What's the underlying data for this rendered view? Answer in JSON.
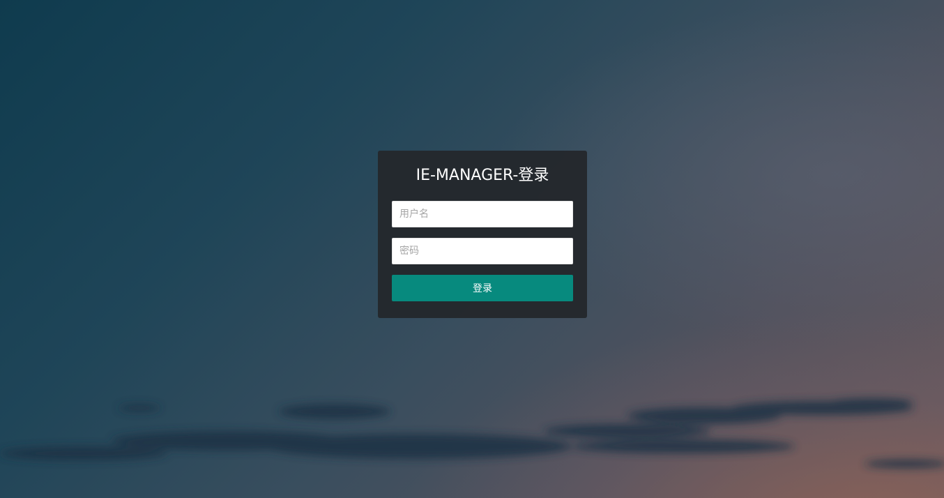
{
  "login": {
    "title": "IE-MANAGER-登录",
    "username_placeholder": "用户名",
    "password_placeholder": "密码",
    "submit_label": "登录"
  },
  "colors": {
    "panel": "#24282c",
    "button": "#078a7e",
    "title_text": "#ffffff"
  }
}
